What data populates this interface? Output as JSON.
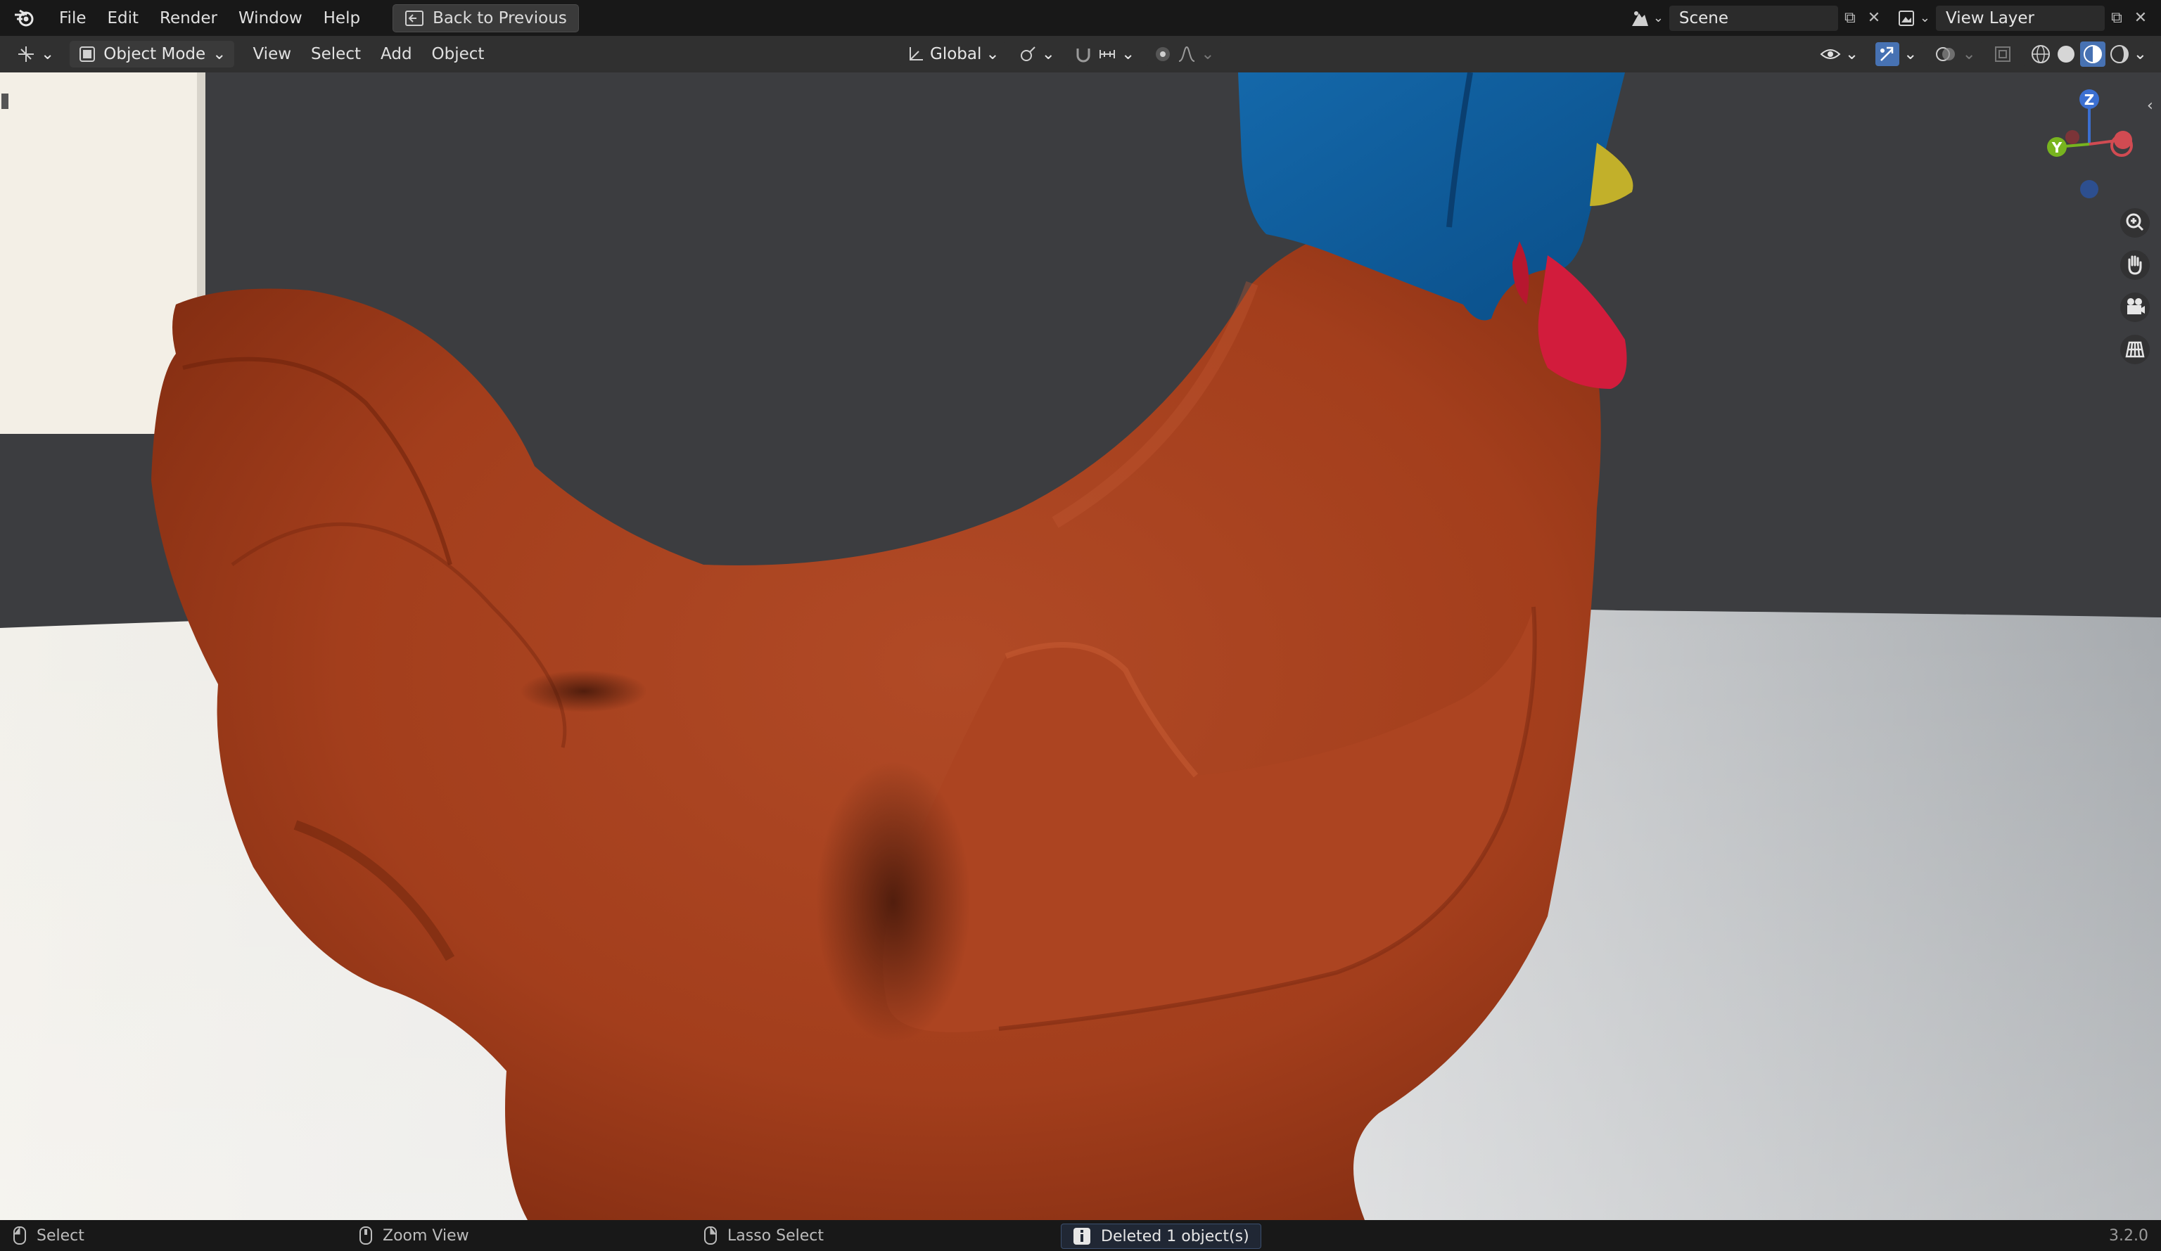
{
  "topbar": {
    "menus": [
      "File",
      "Edit",
      "Render",
      "Window",
      "Help"
    ],
    "back_button": "Back to Previous",
    "scene_name": "Scene",
    "view_layer_name": "View Layer"
  },
  "header": {
    "mode": "Object Mode",
    "menus": [
      "View",
      "Select",
      "Add",
      "Object"
    ],
    "transform_orientation": "Global"
  },
  "viewport": {
    "gizmo_axes": [
      "Z",
      "Y"
    ],
    "navigation_icons": [
      "zoom-icon",
      "pan-hand-icon",
      "camera-icon",
      "grid-icon"
    ]
  },
  "status": {
    "left_click": "Select",
    "middle_click": "Zoom View",
    "right_click": "Lasso Select",
    "message": "Deleted 1 object(s)",
    "version": "3.2.0"
  },
  "colors": {
    "body": "#a9401f",
    "hat": "#0d5a9a",
    "comb": "#d21c3c",
    "beak": "#c2b02a",
    "accent": "#4772b3"
  }
}
